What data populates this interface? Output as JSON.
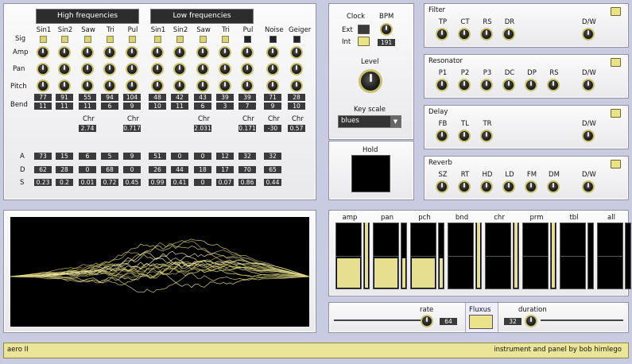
{
  "voices": {
    "high_label": "High frequencies",
    "low_label": "Low frequencies",
    "columns": [
      "Sin1",
      "Sin2",
      "Saw",
      "Tri",
      "Pul",
      "Sin1",
      "Sin2",
      "Saw",
      "Tri",
      "Pul",
      "Noise",
      "Geiger"
    ],
    "row_labels": {
      "sig": "Sig",
      "amp": "Amp",
      "pan": "Pan",
      "pitch": "Pitch",
      "bend": "Bend"
    },
    "sig_on": [
      true,
      true,
      true,
      true,
      true,
      true,
      true,
      true,
      true,
      false,
      false,
      false
    ],
    "pitch_values": [
      "77",
      "91",
      "55",
      "94",
      "104",
      "48",
      "42",
      "43",
      "39",
      "39",
      "71",
      "28"
    ],
    "bend_values": [
      "11",
      "11",
      "11",
      "6",
      "9",
      "10",
      "11",
      "6",
      "3",
      "7",
      "9",
      "10"
    ],
    "chr_label": "Chr",
    "chr_values": [
      "2.74",
      "0.717",
      "2.031",
      "0.171",
      "-30",
      "0.57"
    ],
    "a_label": "A",
    "d_label": "D",
    "s_label": "S",
    "a_values": [
      "73",
      "15",
      "6",
      "5",
      "9",
      "51",
      "0",
      "0",
      "12",
      "32",
      "32"
    ],
    "d_values": [
      "62",
      "28",
      "0",
      "68",
      "0",
      "26",
      "44",
      "18",
      "17",
      "70",
      "65"
    ],
    "s_values": [
      "0.23",
      "0.2",
      "0.01",
      "0.72",
      "0.45",
      "0.99",
      "0.41",
      "0",
      "0.07",
      "0.86",
      "0.44"
    ]
  },
  "clock": {
    "title": "Clock",
    "ext_label": "Ext",
    "int_label": "Int",
    "bpm_label": "BPM",
    "bpm_value": "191",
    "level_label": "Level",
    "keyscale_label": "Key scale",
    "keyscale_value": "blues",
    "hold_label": "Hold"
  },
  "effects": [
    {
      "title": "Filter",
      "knobs": [
        "TP",
        "CT",
        "RS",
        "DR"
      ],
      "dw": "D/W"
    },
    {
      "title": "Resonator",
      "knobs": [
        "P1",
        "P2",
        "P3",
        "DC",
        "DP",
        "RS"
      ],
      "dw": "D/W"
    },
    {
      "title": "Delay",
      "knobs": [
        "FB",
        "TL",
        "TR"
      ],
      "dw": "D/W"
    },
    {
      "title": "Reverb",
      "knobs": [
        "SZ",
        "RT",
        "HD",
        "LD",
        "FM",
        "DM"
      ],
      "dw": "D/W"
    }
  ],
  "sequencer": {
    "columns": [
      {
        "label": "amp",
        "fill": 0.45,
        "side_fill": 1.0
      },
      {
        "label": "pan",
        "fill": 0.45,
        "side_fill": 0.45
      },
      {
        "label": "pch",
        "fill": 0.45,
        "side_fill": 0.45
      },
      {
        "label": "bnd",
        "fill": 0,
        "side_fill": 1.0
      },
      {
        "label": "chr",
        "fill": 0,
        "side_fill": 1.0
      },
      {
        "label": "prm",
        "fill": 0,
        "side_fill": 1.0
      },
      {
        "label": "tbl",
        "fill": 0,
        "side_fill": 0
      },
      {
        "label": "all",
        "fill": 0,
        "side_fill": 0
      }
    ]
  },
  "transport": {
    "rate_label": "rate",
    "rate_value": "64",
    "fluxus_label": "Fluxus",
    "duration_label": "duration",
    "duration_value": "32"
  },
  "footer": {
    "left": "aero II",
    "right": "instrument and panel by bob hirnlego"
  },
  "colors": {
    "accent": "#d9d27a",
    "background": "#c9cbe0"
  }
}
